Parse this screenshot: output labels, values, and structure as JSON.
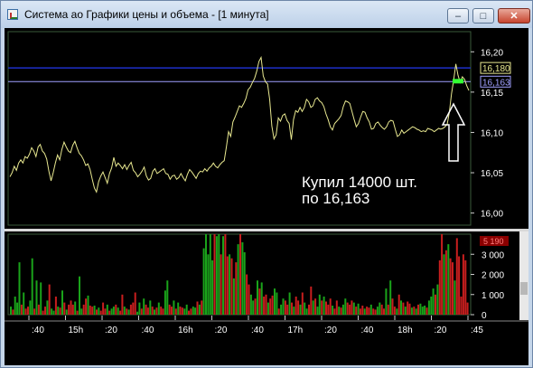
{
  "window": {
    "title": "Система ао Графики цены и объема - [1 минута]",
    "controls": {
      "minimize": "–",
      "maximize": "□",
      "close": "✕"
    }
  },
  "colors": {
    "background": "#000000",
    "price_line": "#e8e890",
    "upper_level": "#1e2fc8",
    "lower_level": "#a0a0ff",
    "buy_marker": "#33ff33",
    "volume_green": "#1aa31a",
    "volume_red": "#c81e1e",
    "axis_text": "#ffffff",
    "grid": "#3a5a3a"
  },
  "annotation": {
    "line1": "Купил 14000 шт.",
    "line2": "по 16,163",
    "arrow_icon": "up-arrow-icon"
  },
  "price_axis": {
    "ticks": [
      "16,20",
      "16,15",
      "16,10",
      "16,05",
      "16,00"
    ],
    "tick_values": [
      16.2,
      16.15,
      16.1,
      16.05,
      16.0
    ],
    "range": [
      15.985,
      16.225
    ],
    "level_high": {
      "label": "16,180",
      "value": 16.18
    },
    "level_buy": {
      "label": "16,163",
      "value": 16.163
    }
  },
  "volume_axis": {
    "ticks": [
      "3 000",
      "2 000",
      "1 000",
      "0"
    ],
    "tick_values": [
      3000,
      2000,
      1000,
      0
    ],
    "range": [
      0,
      4000
    ],
    "last_volume_label": "5 190"
  },
  "time_axis": {
    "labels": [
      ":40",
      "15h",
      ":20",
      ":40",
      "16h",
      ":20",
      ":40",
      "17h",
      ":20",
      ":40",
      "18h",
      ":20",
      ":45"
    ]
  },
  "chart_data": {
    "type": "line",
    "price_series": {
      "values": [
        16.045,
        16.05,
        16.058,
        16.053,
        16.062,
        16.066,
        16.062,
        16.07,
        16.068,
        16.073,
        16.081,
        16.077,
        16.07,
        16.082,
        16.085,
        16.077,
        16.074,
        16.067,
        16.052,
        16.04,
        16.05,
        16.062,
        16.072,
        16.066,
        16.079,
        16.088,
        16.082,
        16.077,
        16.075,
        16.084,
        16.089,
        16.081,
        16.074,
        16.071,
        16.066,
        16.059,
        16.061,
        16.054,
        16.042,
        16.031,
        16.026,
        16.039,
        16.046,
        16.051,
        16.044,
        16.037,
        16.049,
        16.056,
        16.069,
        16.058,
        16.062,
        16.059,
        16.055,
        16.06,
        16.054,
        16.059,
        16.063,
        16.053,
        16.05,
        16.045,
        16.048,
        16.052,
        16.057,
        16.046,
        16.041,
        16.043,
        16.052,
        16.055,
        16.049,
        16.051,
        16.053,
        16.055,
        16.049,
        16.048,
        16.042,
        16.046,
        16.047,
        16.042,
        16.044,
        16.049,
        16.044,
        16.04,
        16.048,
        16.054,
        16.051,
        16.047,
        16.043,
        16.049,
        16.052,
        16.051,
        16.055,
        16.052,
        16.056,
        16.058,
        16.062,
        16.058,
        16.056,
        16.06,
        16.063,
        16.065,
        16.082,
        16.101,
        16.095,
        16.113,
        16.119,
        16.126,
        16.133,
        16.131,
        16.136,
        16.142,
        16.153,
        16.156,
        16.162,
        16.167,
        16.176,
        16.188,
        16.193,
        16.17,
        16.163,
        16.16,
        16.141,
        16.108,
        16.092,
        16.097,
        16.118,
        16.114,
        16.121,
        16.123,
        16.115,
        16.111,
        16.091,
        16.116,
        16.127,
        16.125,
        16.131,
        16.126,
        16.131,
        16.141,
        16.138,
        16.131,
        16.133,
        16.141,
        16.143,
        16.139,
        16.137,
        16.132,
        16.123,
        16.116,
        16.107,
        16.103,
        16.111,
        16.114,
        16.117,
        16.121,
        16.132,
        16.139,
        16.138,
        16.136,
        16.126,
        16.116,
        16.107,
        16.111,
        16.119,
        16.126,
        16.125,
        16.118,
        16.113,
        16.104,
        16.105,
        16.111,
        16.113,
        16.109,
        16.106,
        16.104,
        16.107,
        16.113,
        16.115,
        16.114,
        16.104,
        16.095,
        16.097,
        16.103,
        16.099,
        16.101,
        16.103,
        16.105,
        16.107,
        16.106,
        16.104,
        16.103,
        16.101,
        16.102,
        16.101,
        16.105,
        16.104,
        16.103,
        16.101,
        16.103,
        16.105,
        16.104,
        16.105,
        16.107,
        16.11,
        16.125,
        16.148,
        16.165,
        16.185,
        16.171,
        16.162,
        16.169,
        16.166,
        16.158,
        16.152
      ]
    },
    "horizontal_levels": [
      16.18,
      16.163
    ],
    "volume_series": {
      "values": [
        400,
        250,
        900,
        600,
        2600,
        500,
        1100,
        300,
        400,
        700,
        2800,
        300,
        1700,
        500,
        1600,
        200,
        400,
        700,
        1500,
        300,
        200,
        900,
        400,
        350,
        1200,
        600,
        250,
        500,
        700,
        500,
        650,
        200,
        1900,
        300,
        500,
        800,
        950,
        450,
        400,
        450,
        250,
        350,
        200,
        600,
        300,
        500,
        200,
        300,
        400,
        500,
        350,
        200,
        1000,
        400,
        300,
        250,
        500,
        600,
        1100,
        150,
        600,
        300,
        800,
        500,
        350,
        700,
        400,
        250,
        350,
        600,
        400,
        300,
        1200,
        1700,
        500,
        400,
        700,
        300,
        600,
        400,
        350,
        300,
        500,
        200,
        300,
        400,
        350,
        650,
        500,
        700,
        3300,
        4000,
        3000,
        4100,
        2700,
        4200,
        3900,
        4100,
        3000,
        3900,
        4000,
        2900,
        3000,
        2800,
        1800,
        2600,
        3500,
        4100,
        3600,
        3100,
        2000,
        1500,
        1000,
        700,
        800,
        1700,
        1300,
        1600,
        900,
        1000,
        600,
        800,
        950,
        1300,
        1100,
        300,
        500,
        800,
        700,
        500,
        1100,
        600,
        400,
        900,
        700,
        500,
        1100,
        600,
        300,
        500,
        1400,
        700,
        800,
        400,
        1000,
        700,
        900,
        650,
        500,
        800,
        450,
        300,
        700,
        400,
        350,
        500,
        800,
        600,
        500,
        700,
        600,
        400,
        550,
        300,
        450,
        300,
        400,
        350,
        500,
        300,
        250,
        400,
        600,
        500,
        300,
        1300,
        500,
        1700,
        800,
        400,
        300,
        1000,
        700,
        600,
        400,
        650,
        550,
        350,
        400,
        300,
        500,
        550,
        400,
        450,
        350,
        700,
        900,
        1300,
        1000,
        1500,
        2700,
        4000,
        3000,
        3200,
        3500,
        2800,
        2600,
        1700,
        3800,
        2900,
        900,
        3000,
        2700,
        600
      ],
      "up_flags": [
        1,
        0,
        1,
        1,
        1,
        0,
        1,
        0,
        0,
        1,
        1,
        0,
        1,
        0,
        1,
        0,
        0,
        1,
        0,
        1,
        1,
        0,
        1,
        0,
        1,
        0,
        1,
        0,
        0,
        0,
        1,
        0,
        1,
        1,
        0,
        0,
        1,
        0,
        0,
        1,
        0,
        1,
        0,
        0,
        0,
        1,
        0,
        1,
        1,
        0,
        1,
        0,
        0,
        1,
        0,
        1,
        0,
        0,
        0,
        1,
        1,
        0,
        1,
        0,
        0,
        1,
        0,
        1,
        0,
        1,
        0,
        0,
        1,
        1,
        0,
        0,
        1,
        0,
        1,
        0,
        0,
        1,
        1,
        0,
        0,
        1,
        1,
        0,
        1,
        0,
        1,
        1,
        1,
        1,
        1,
        0,
        1,
        1,
        0,
        1,
        0,
        0,
        1,
        0,
        1,
        0,
        1,
        0,
        1,
        1,
        0,
        0,
        1,
        1,
        0,
        1,
        0,
        1,
        0,
        0,
        1,
        0,
        0,
        1,
        1,
        0,
        1,
        1,
        0,
        0,
        1,
        0,
        1,
        0,
        0,
        1,
        0,
        1,
        1,
        0,
        0,
        1,
        0,
        1,
        1,
        0,
        1,
        0,
        0,
        0,
        1,
        0,
        0,
        1,
        0,
        1,
        1,
        0,
        0,
        0,
        1,
        0,
        1,
        0,
        0,
        1,
        0,
        0,
        1,
        0,
        0,
        1,
        1,
        0,
        0,
        1,
        0,
        1,
        0,
        0,
        1,
        0,
        1,
        0,
        1,
        0,
        0,
        1,
        0,
        1,
        0,
        1,
        1,
        1,
        0,
        1,
        1,
        1,
        0,
        1,
        0,
        0,
        1,
        0,
        1,
        0,
        0,
        1,
        0,
        0
      ]
    }
  }
}
